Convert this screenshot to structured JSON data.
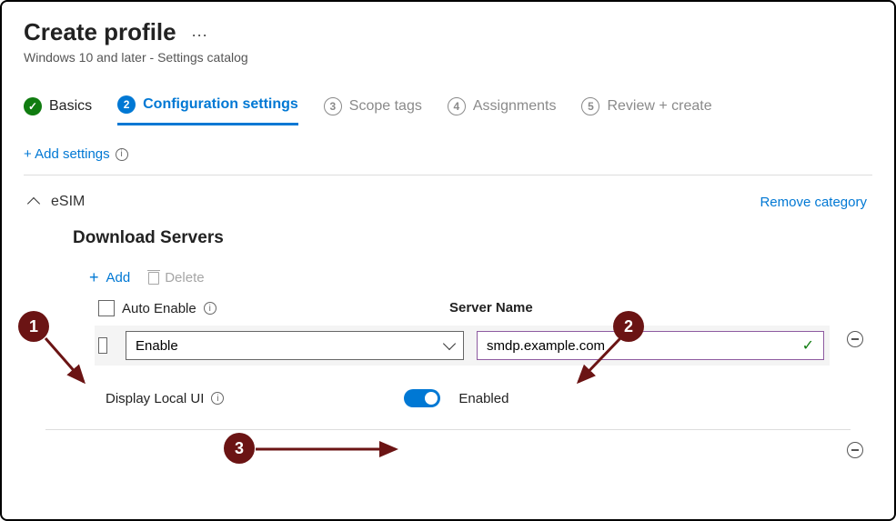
{
  "page": {
    "title": "Create profile",
    "subtitle": "Windows 10 and later - Settings catalog"
  },
  "wizard": {
    "steps": [
      {
        "label": "Basics",
        "state": "done"
      },
      {
        "num": "2",
        "label": "Configuration settings",
        "state": "active"
      },
      {
        "num": "3",
        "label": "Scope tags",
        "state": "todo"
      },
      {
        "num": "4",
        "label": "Assignments",
        "state": "todo"
      },
      {
        "num": "5",
        "label": "Review + create",
        "state": "todo"
      }
    ]
  },
  "addSettingsLabel": "+ Add settings",
  "category": {
    "name": "eSIM",
    "removeLabel": "Remove category"
  },
  "section": {
    "title": "Download Servers",
    "addLabel": "Add",
    "deleteLabel": "Delete",
    "columns": {
      "autoEnable": "Auto Enable",
      "serverName": "Server Name"
    },
    "row": {
      "selectValue": "Enable",
      "serverValue": "smdp.example.com"
    },
    "localUi": {
      "label": "Display Local UI",
      "stateLabel": "Enabled"
    }
  },
  "callouts": {
    "c1": "1",
    "c2": "2",
    "c3": "3"
  }
}
